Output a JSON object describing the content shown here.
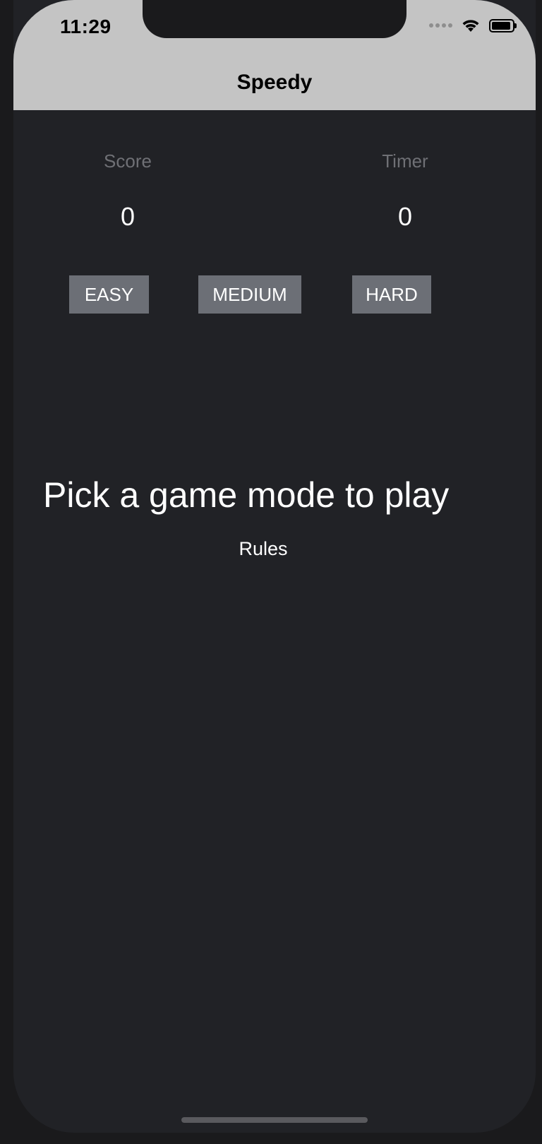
{
  "status_bar": {
    "time": "11:29",
    "icons": [
      "signal-dots-icon",
      "wifi-icon",
      "battery-icon"
    ]
  },
  "nav": {
    "title": "Speedy"
  },
  "stats": {
    "score_label": "Score",
    "score_value": "0",
    "timer_label": "Timer",
    "timer_value": "0"
  },
  "modes": {
    "easy": "EASY",
    "medium": "MEDIUM",
    "hard": "HARD"
  },
  "main": {
    "prompt": "Pick a game mode to play",
    "rules_link": "Rules"
  },
  "colors": {
    "background": "#212226",
    "header": "#c4c4c4",
    "button": "#6c6f76",
    "label": "#6f7075",
    "text": "#ffffff"
  }
}
